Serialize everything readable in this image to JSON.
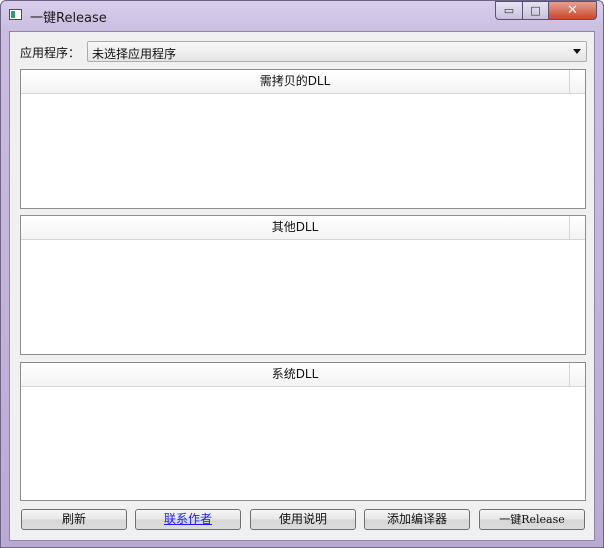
{
  "window": {
    "title": "一键Release",
    "controls": {
      "minimize": "▭",
      "maximize": "□",
      "close": "✕"
    }
  },
  "app_selector": {
    "label": "应用程序：",
    "value": "未选择应用程序"
  },
  "panels": [
    {
      "header": "需拷贝的DLL"
    },
    {
      "header": "其他DLL"
    },
    {
      "header": "系统DLL"
    }
  ],
  "buttons": {
    "refresh": "刷新",
    "contact": "联系作者",
    "help": "使用说明",
    "add_compiler": "添加编译器",
    "release": "一键Release"
  },
  "colors": {
    "link": "#1a1aff",
    "close_button": "#c9462b"
  }
}
